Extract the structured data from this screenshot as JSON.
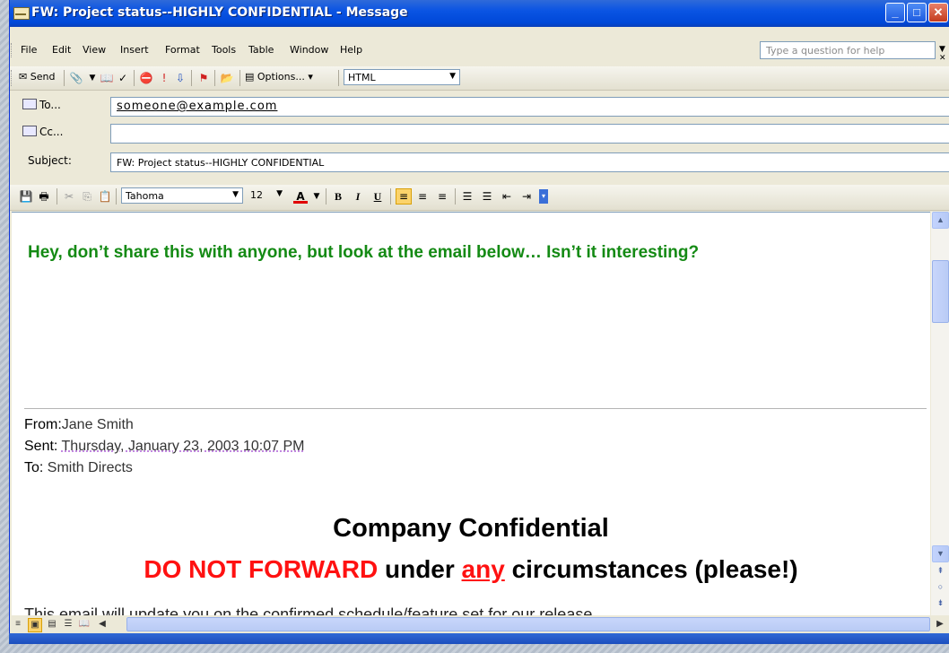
{
  "window": {
    "title": "FW: Project status--HIGHLY CONFIDENTIAL - Message"
  },
  "menu": {
    "items": [
      "File",
      "Edit",
      "View",
      "Insert",
      "Format",
      "Tools",
      "Table",
      "Window",
      "Help"
    ],
    "help_placeholder": "Type a question for help"
  },
  "toolbar": {
    "send_label": "Send",
    "options_label": "Options...",
    "format_value": "HTML"
  },
  "header": {
    "to_label": "To...",
    "to_value": "someone@example.com",
    "cc_label": "Cc...",
    "cc_value": "",
    "subject_label": "Subject:",
    "subject_value": "FW: Project status--HIGHLY CONFIDENTIAL"
  },
  "format_toolbar": {
    "font": "Tahoma",
    "size": "12",
    "bold": "B",
    "italic": "I",
    "underline": "U"
  },
  "body": {
    "intro": "Hey, don’t share this with anyone, but look at the email below… Isn’t it interesting?",
    "from_label": "From:",
    "from_value": "Jane Smith",
    "sent_label": "Sent:",
    "sent_value": "Thursday, January 23, 2003 10:07 PM",
    "to_label": "To:",
    "to_value": "Smith Directs",
    "heading": "Company Confidential",
    "warning_part1": "DO NOT FORWARD",
    "warning_part2": " under ",
    "warning_part3": "any",
    "warning_part4": " circumstances (please!)",
    "paragraph": "This email will update you on the confirmed schedule/feature set for our release,"
  },
  "colors": {
    "titlebar": "#0a54e3",
    "intro_text": "#148a14",
    "warning_red": "#ff1111"
  }
}
